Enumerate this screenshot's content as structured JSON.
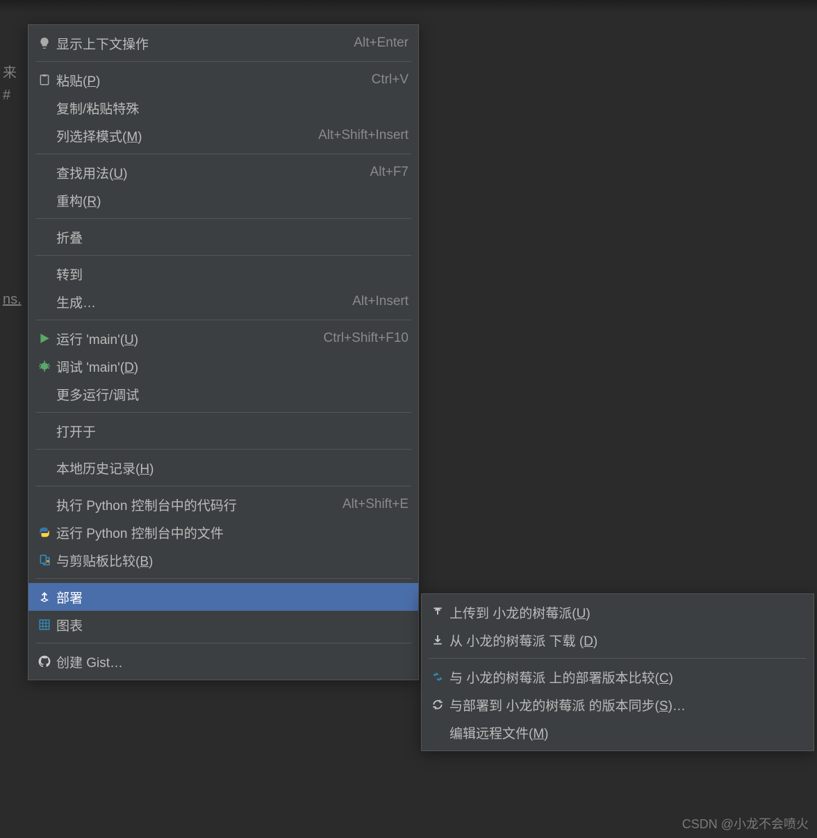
{
  "editor": {
    "line1": "来",
    "line2": "#",
    "line3": "",
    "line4": "ns."
  },
  "menu": {
    "g1": [
      {
        "icon": "bulb",
        "label": "显示上下文操作",
        "shortcut": "Alt+Enter"
      }
    ],
    "g2": [
      {
        "icon": "paste",
        "pre": "粘贴(",
        "mn": "P",
        "post": ")",
        "shortcut": "Ctrl+V"
      },
      {
        "label": "复制/粘贴特殊",
        "submenu": true
      },
      {
        "pre": "列选择模式(",
        "mn": "M",
        "post": ")",
        "shortcut": "Alt+Shift+Insert"
      }
    ],
    "g3": [
      {
        "pre": "查找用法(",
        "mn": "U",
        "post": ")",
        "shortcut": "Alt+F7"
      },
      {
        "pre": "重构(",
        "mn": "R",
        "post": ")",
        "submenu": true
      }
    ],
    "g4": [
      {
        "label": "折叠",
        "submenu": true
      }
    ],
    "g5": [
      {
        "label": "转到",
        "submenu": true
      },
      {
        "label": "生成…",
        "shortcut": "Alt+Insert"
      }
    ],
    "g6": [
      {
        "icon": "run",
        "pre": "运行 'main'(",
        "mn": "U",
        "post": ")",
        "shortcut": "Ctrl+Shift+F10"
      },
      {
        "icon": "debug",
        "pre": "调试 'main'(",
        "mn": "D",
        "post": ")"
      },
      {
        "label": "更多运行/调试",
        "submenu": true
      }
    ],
    "g7": [
      {
        "label": "打开于",
        "submenu": true
      }
    ],
    "g8": [
      {
        "pre": "本地历史记录(",
        "mn": "H",
        "post": ")",
        "submenu": true
      }
    ],
    "g9": [
      {
        "label": "执行 Python 控制台中的代码行",
        "shortcut": "Alt+Shift+E"
      },
      {
        "icon": "python",
        "label": "运行 Python 控制台中的文件"
      },
      {
        "icon": "clip",
        "pre": "与剪贴板比较(",
        "mn": "B",
        "post": ")"
      }
    ],
    "g10": [
      {
        "icon": "deploy",
        "label": "部署",
        "submenu": true,
        "highlight": true
      },
      {
        "icon": "diagram",
        "label": "图表",
        "submenu": true
      }
    ],
    "g11": [
      {
        "icon": "github",
        "label": "创建 Gist…"
      }
    ]
  },
  "submenu": {
    "g1": [
      {
        "icon": "upload",
        "pre": "上传到 小龙的树莓派(",
        "mn": "U",
        "post": ")"
      },
      {
        "icon": "download",
        "pre": "从 小龙的树莓派 下载 (",
        "mn": "D",
        "post": ")"
      }
    ],
    "g2": [
      {
        "icon": "compare",
        "pre": "与 小龙的树莓派 上的部署版本比较(",
        "mn": "C",
        "post": ")"
      },
      {
        "icon": "sync",
        "pre": "与部署到 小龙的树莓派 的版本同步(",
        "mn": "S",
        "post": ")…"
      },
      {
        "pre": "编辑远程文件(",
        "mn": "M",
        "post": ")"
      }
    ]
  },
  "watermark": "CSDN @小龙不会喷火"
}
